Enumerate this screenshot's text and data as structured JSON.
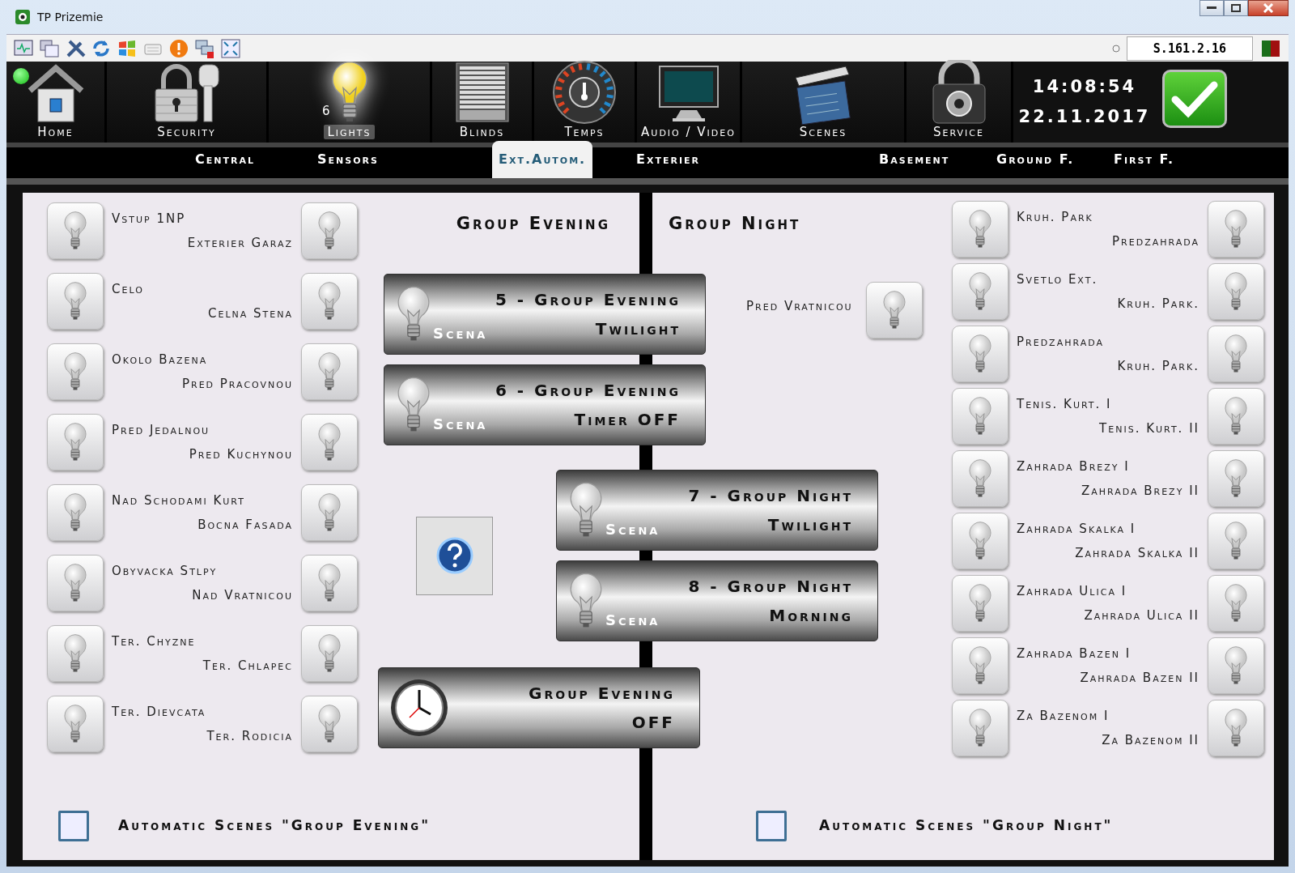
{
  "window": {
    "title": "TP Prizemie"
  },
  "toolbar": {
    "address": "S.161.2.16"
  },
  "connection": {
    "online": true
  },
  "nav": [
    {
      "label": "Home",
      "kind": "home",
      "selected": false
    },
    {
      "label": "Security",
      "kind": "security",
      "selected": false
    },
    {
      "label": "Lights",
      "kind": "lights",
      "selected": true,
      "count": "6"
    },
    {
      "label": "Blinds",
      "kind": "blinds",
      "selected": false
    },
    {
      "label": "Temps",
      "kind": "temps",
      "selected": false
    },
    {
      "label": "Audio / Video",
      "kind": "av",
      "selected": false
    },
    {
      "label": "Scenes",
      "kind": "scenes",
      "selected": false
    },
    {
      "label": "Service",
      "kind": "service",
      "selected": false
    }
  ],
  "clock": {
    "time": "14:08:54",
    "date": "22.11.2017"
  },
  "tabs": [
    {
      "label": "Central",
      "selected": false
    },
    {
      "label": "Sensors",
      "selected": false
    },
    {
      "label": "Ext.Autom.",
      "selected": true
    },
    {
      "label": "Exterier",
      "selected": false
    },
    {
      "label": "Basement",
      "selected": false
    },
    {
      "label": "Ground F.",
      "selected": false
    },
    {
      "label": "First F.",
      "selected": false
    }
  ],
  "evening": {
    "title": "Group Evening",
    "lights": [
      {
        "line1": "Vstup 1NP",
        "line2": "Exterier Garaz"
      },
      {
        "line1": "Celo",
        "line2": "Celna Stena"
      },
      {
        "line1": "Okolo Bazena",
        "line2": "Pred Pracovnou"
      },
      {
        "line1": "Pred Jedalnou",
        "line2": "Pred Kuchynou"
      },
      {
        "line1": "Nad Schodami Kurt",
        "line2": "Bocna Fasada"
      },
      {
        "line1": "Obyvacka Stlpy",
        "line2": "Nad Vratnicou"
      },
      {
        "line1": "Ter. Chyzne",
        "line2": "Ter. Chlapec"
      },
      {
        "line1": "Ter. Dievcata",
        "line2": "Ter. Rodicia"
      }
    ],
    "scenes": [
      {
        "title": "5 - Group Evening",
        "subtitle": "Twilight",
        "tag": "Scena"
      },
      {
        "title": "6 - Group Evening",
        "subtitle": "Timer OFF",
        "tag": "Scena"
      }
    ],
    "off_button": {
      "line1": "Group Evening",
      "line2": "OFF"
    },
    "auto": {
      "label": "Automatic Scenes \"Group Evening\"",
      "checked": false
    }
  },
  "night": {
    "title": "Group Night",
    "extra_light": {
      "label": "Pred Vratnicou"
    },
    "lights": [
      {
        "line1": "Kruh. Park",
        "line2": "Predzahrada"
      },
      {
        "line1": "Svetlo Ext.",
        "line2": "Kruh. Park."
      },
      {
        "line1": "Predzahrada",
        "line2": "Kruh. Park."
      },
      {
        "line1": "Tenis. Kurt. I",
        "line2": "Tenis. Kurt. II"
      },
      {
        "line1": "Zahrada Brezy I",
        "line2": "Zahrada Brezy II"
      },
      {
        "line1": "Zahrada Skalka I",
        "line2": "Zahrada Skalka II"
      },
      {
        "line1": "Zahrada Ulica I",
        "line2": "Zahrada Ulica II"
      },
      {
        "line1": "Zahrada Bazen I",
        "line2": "Zahrada Bazen II"
      },
      {
        "line1": "Za Bazenom I",
        "line2": "Za Bazenom II"
      }
    ],
    "scenes": [
      {
        "title": "7 - Group Night",
        "subtitle": "Twilight",
        "tag": "Scena"
      },
      {
        "title": "8 - Group Night",
        "subtitle": "Morning",
        "tag": "Scena"
      }
    ],
    "auto": {
      "label": "Automatic Scenes \"Group Night\"",
      "checked": false
    }
  }
}
